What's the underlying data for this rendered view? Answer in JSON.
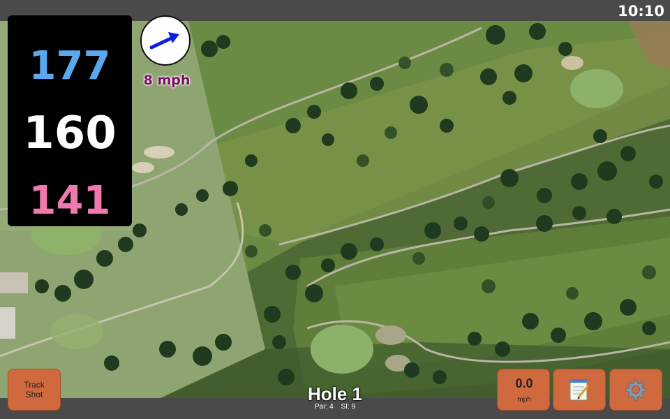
{
  "status_bar": {
    "time": "10:10"
  },
  "distances": {
    "back": "177",
    "middle": "160",
    "front": "141"
  },
  "wind": {
    "speed_label": "8 mph",
    "icon": "wind-arrow-icon"
  },
  "hole": {
    "title": "Hole 1",
    "par_label": "Par: 4",
    "si_label": "SI: 9"
  },
  "buttons": {
    "track_shot_line1": "Track",
    "track_shot_line2": "Shot",
    "speed_value": "0.0",
    "speed_unit": "mph",
    "notes_icon": "notepad-icon",
    "settings_icon": "gear-icon"
  },
  "colors": {
    "back_distance": "#5aa8ee",
    "middle_distance": "#ffffff",
    "front_distance": "#f07ab0",
    "button_accent": "#d06a3e",
    "wind_speed_text": "#7a0d63"
  }
}
